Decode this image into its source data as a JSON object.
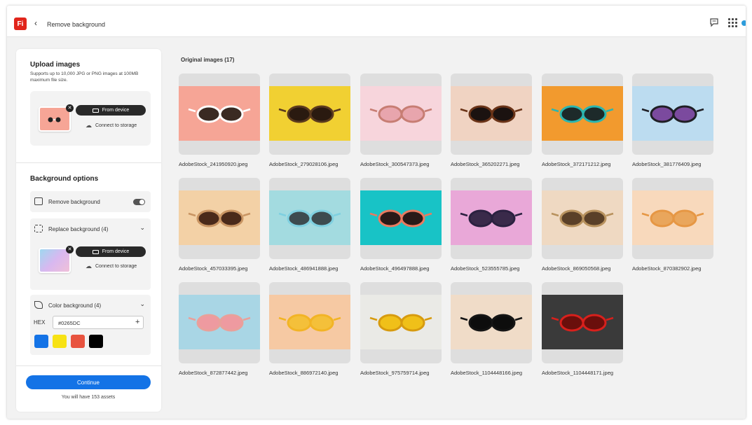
{
  "topbar": {
    "app_logo": "Fi",
    "back_glyph": "‹",
    "breadcrumb": "Remove background",
    "icons": [
      "chat-icon",
      "apps-grid-icon"
    ]
  },
  "sidebar": {
    "upload": {
      "title": "Upload images",
      "subtitle": "Supports up to 10,000 JPG or PNG images at 100MB maximum file size.",
      "from_device": "From device",
      "connect_storage": "Connect to storage"
    },
    "background_options": {
      "title": "Background options",
      "remove_background": {
        "label": "Remove background",
        "enabled": true
      },
      "replace_background": {
        "label": "Replace background (4)",
        "from_device": "From device",
        "connect_storage": "Connect to storage"
      },
      "color_background": {
        "label": "Color background (4)",
        "hex_label": "HEX",
        "hex_value": "#0265DC",
        "swatches": [
          "#1473e6",
          "#f7e214",
          "#e8533f",
          "#000000"
        ]
      }
    },
    "continue_label": "Continue",
    "assets_note": "You will have 153 assets"
  },
  "gallery": {
    "title": "Original images (17)",
    "images": [
      {
        "filename": "AdobeStock_241950920.jpeg",
        "bg": "#f6a596",
        "frame": "#ffffff",
        "lens": "#3a2a22"
      },
      {
        "filename": "AdobeStock_279028106.jpeg",
        "bg": "#f1d032",
        "frame": "#5b3a1e",
        "lens": "#2a1a10"
      },
      {
        "filename": "AdobeStock_300547373.jpeg",
        "bg": "#f7d5dc",
        "frame": "#c77d73",
        "lens": "#e8a5ad"
      },
      {
        "filename": "AdobeStock_365202271.jpeg",
        "bg": "#f0d3c2",
        "frame": "#6b3418",
        "lens": "#1b1210"
      },
      {
        "filename": "AdobeStock_372171212.jpeg",
        "bg": "#f29a2e",
        "frame": "#2bb6b0",
        "lens": "#1d2a2a"
      },
      {
        "filename": "AdobeStock_381776409.jpeg",
        "bg": "#bcdcf0",
        "frame": "#1f1f25",
        "lens": "#7b4a9e"
      },
      {
        "filename": "AdobeStock_457033395.jpeg",
        "bg": "#f3d1a6",
        "frame": "#c99563",
        "lens": "#4a2a1a"
      },
      {
        "filename": "AdobeStock_486941888.jpeg",
        "bg": "#a3dbe0",
        "frame": "#7fd0e0",
        "lens": "#3d4b4f"
      },
      {
        "filename": "AdobeStock_496497888.jpeg",
        "bg": "#18c3c6",
        "frame": "#e97a60",
        "lens": "#2a1a18"
      },
      {
        "filename": "AdobeStock_523555785.jpeg",
        "bg": "#e9a8d8",
        "frame": "#2b2140",
        "lens": "#3a2a4a"
      },
      {
        "filename": "AdobeStock_869050568.jpeg",
        "bg": "#efd9c2",
        "frame": "#b8925e",
        "lens": "#5a4028"
      },
      {
        "filename": "AdobeStock_870382902.jpeg",
        "bg": "#f8d9bc",
        "frame": "#e69744",
        "lens": "#e9a65c"
      },
      {
        "filename": "AdobeStock_872877442.jpeg",
        "bg": "#a9d6e5",
        "frame": "#e9a09a",
        "lens": "#ee9aa0"
      },
      {
        "filename": "AdobeStock_886972140.jpeg",
        "bg": "#f6c9a3",
        "frame": "#f2b425",
        "lens": "#f4c03a"
      },
      {
        "filename": "AdobeStock_975759714.jpeg",
        "bg": "#eaeae6",
        "frame": "#d79b0f",
        "lens": "#f0c019"
      },
      {
        "filename": "AdobeStock_1104448166.jpeg",
        "bg": "#f0dcc8",
        "frame": "#151515",
        "lens": "#0d0d0d"
      },
      {
        "filename": "AdobeStock_1104448171.jpeg",
        "bg": "#3a3a3a",
        "frame": "#d8201c",
        "lens": "#6a0f0c"
      }
    ]
  }
}
